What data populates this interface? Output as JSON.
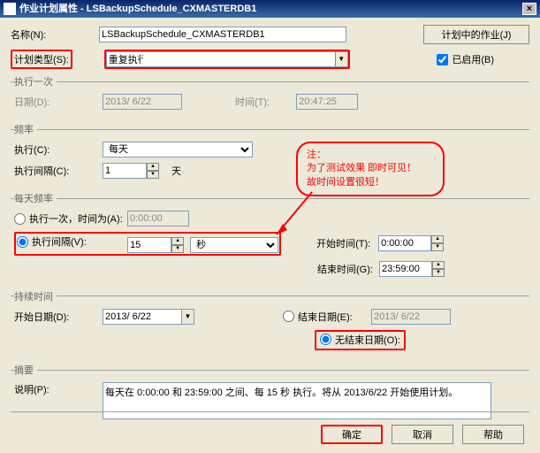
{
  "titlebar": {
    "title": "作业计划属性 - LSBackupSchedule_CXMASTERDB1",
    "close": "×"
  },
  "top": {
    "name_label": "名称(N):",
    "name_value": "LSBackupSchedule_CXMASTERDB1",
    "jobs_button": "计划中的作业(J)",
    "type_label": "计划类型(S):",
    "type_value": "重复执行",
    "enabled_label": "已启用(B)"
  },
  "once": {
    "legend": "执行一次",
    "date_label": "日期(D):",
    "date_value": "2013/ 6/22",
    "time_label": "时间(T):",
    "time_value": "20:47:25"
  },
  "freq": {
    "legend": "频率",
    "exec_label": "执行(C):",
    "exec_value": "每天",
    "interval_label": "执行间隔(C):",
    "interval_value": "1",
    "interval_unit": "天"
  },
  "daily": {
    "legend": "每天频率",
    "once_radio": "执行一次，时间为(A):",
    "once_time": "0:00:00",
    "interval_radio": "执行间隔(V):",
    "interval_value": "15",
    "interval_unit": "秒",
    "start_time_label": "开始时间(T):",
    "start_time_value": "0:00:00",
    "end_time_label": "结束时间(G):",
    "end_time_value": "23:59:00"
  },
  "duration": {
    "legend": "持续时间",
    "start_date_label": "开始日期(D):",
    "start_date_value": "2013/ 6/22",
    "end_date_radio": "结束日期(E):",
    "end_date_value": "2013/ 6/22",
    "no_end_radio": "无结束日期(O):"
  },
  "summary": {
    "legend": "摘要",
    "desc_label": "说明(P):",
    "desc_value": "每天在 0:00:00 和 23:59:00 之间、每 15 秒 执行。将从 2013/6/22 开始使用计划。"
  },
  "footer": {
    "ok": "确定",
    "cancel": "取消",
    "help": "帮助"
  },
  "annotation": {
    "line1": "注：",
    "line2": "为了测试效果 即时可见！",
    "line3": "故时间设置很短！"
  }
}
